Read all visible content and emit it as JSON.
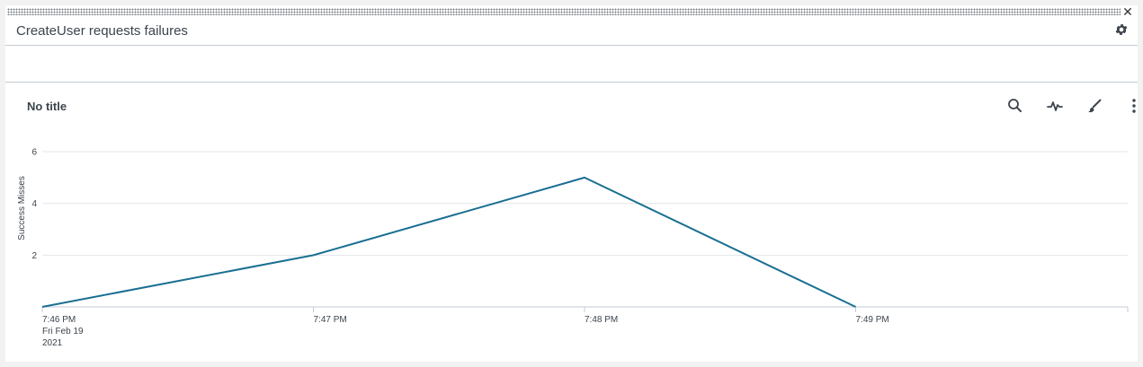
{
  "panel": {
    "title": "CreateUser requests failures",
    "close_icon": "close-icon",
    "settings_icon": "gear-icon"
  },
  "viz": {
    "title": "No title",
    "tools": [
      "search-icon",
      "pulse-icon",
      "brush-icon",
      "more-vertical-icon"
    ]
  },
  "colors": {
    "line": "#1a6f92",
    "grid": "#e3e6ea",
    "axis": "#c3cbd4"
  },
  "chart_data": {
    "type": "line",
    "x": [
      "7:46 PM",
      "7:47 PM",
      "7:48 PM",
      "7:49 PM"
    ],
    "x_first_label_extra": [
      "Fri Feb 19",
      "2021"
    ],
    "series": [
      {
        "values": [
          0,
          2,
          5,
          0
        ]
      }
    ],
    "ylabel": "Success Misses",
    "yticks": [
      2,
      4,
      6
    ],
    "ylim": [
      0,
      6.8
    ],
    "grid": true
  }
}
